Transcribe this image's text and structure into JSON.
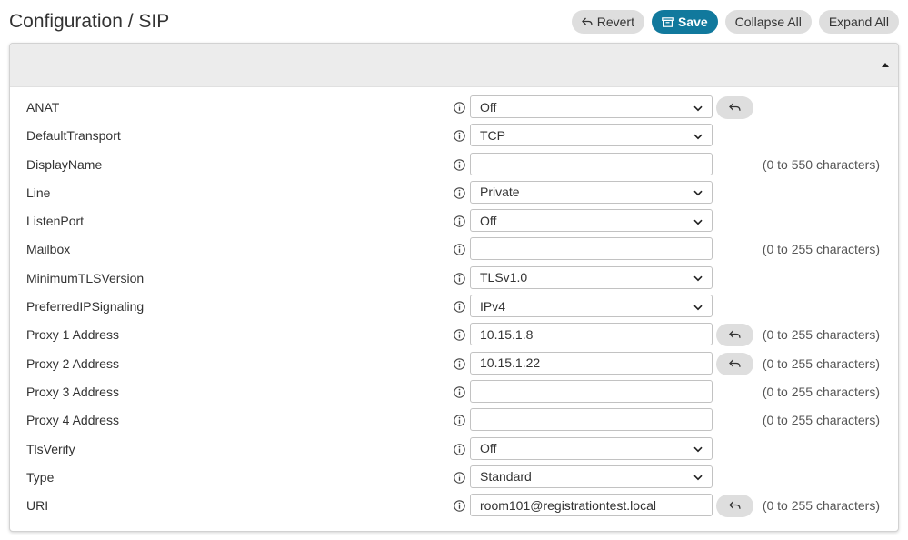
{
  "header": {
    "title": "Configuration / SIP"
  },
  "toolbar": {
    "revert_label": "Revert",
    "save_label": "Save",
    "collapse_all_label": "Collapse All",
    "expand_all_label": "Expand All"
  },
  "colors": {
    "primary": "#11799d",
    "button_bg": "#dedede",
    "panel_header_bg": "#ececec"
  },
  "settings": [
    {
      "name": "ANAT",
      "type": "select",
      "value": "Off",
      "revert": true,
      "hint": ""
    },
    {
      "name": "DefaultTransport",
      "type": "select",
      "value": "TCP",
      "revert": false,
      "hint": ""
    },
    {
      "name": "DisplayName",
      "type": "text",
      "value": "",
      "revert": false,
      "hint": "(0 to 550 characters)"
    },
    {
      "name": "Line",
      "type": "select",
      "value": "Private",
      "revert": false,
      "hint": ""
    },
    {
      "name": "ListenPort",
      "type": "select",
      "value": "Off",
      "revert": false,
      "hint": ""
    },
    {
      "name": "Mailbox",
      "type": "text",
      "value": "",
      "revert": false,
      "hint": "(0 to 255 characters)"
    },
    {
      "name": "MinimumTLSVersion",
      "type": "select",
      "value": "TLSv1.0",
      "revert": false,
      "hint": ""
    },
    {
      "name": "PreferredIPSignaling",
      "type": "select",
      "value": "IPv4",
      "revert": false,
      "hint": ""
    },
    {
      "name": "Proxy 1 Address",
      "type": "text",
      "value": "10.15.1.8",
      "revert": true,
      "hint": "(0 to 255 characters)"
    },
    {
      "name": "Proxy 2 Address",
      "type": "text",
      "value": "10.15.1.22",
      "revert": true,
      "hint": "(0 to 255 characters)"
    },
    {
      "name": "Proxy 3 Address",
      "type": "text",
      "value": "",
      "revert": false,
      "hint": "(0 to 255 characters)"
    },
    {
      "name": "Proxy 4 Address",
      "type": "text",
      "value": "",
      "revert": false,
      "hint": "(0 to 255 characters)"
    },
    {
      "name": "TlsVerify",
      "type": "select",
      "value": "Off",
      "revert": false,
      "hint": ""
    },
    {
      "name": "Type",
      "type": "select",
      "value": "Standard",
      "revert": false,
      "hint": ""
    },
    {
      "name": "URI",
      "type": "text",
      "value": "room101@registrationtest.local",
      "revert": true,
      "hint": "(0 to 255 characters)"
    }
  ]
}
